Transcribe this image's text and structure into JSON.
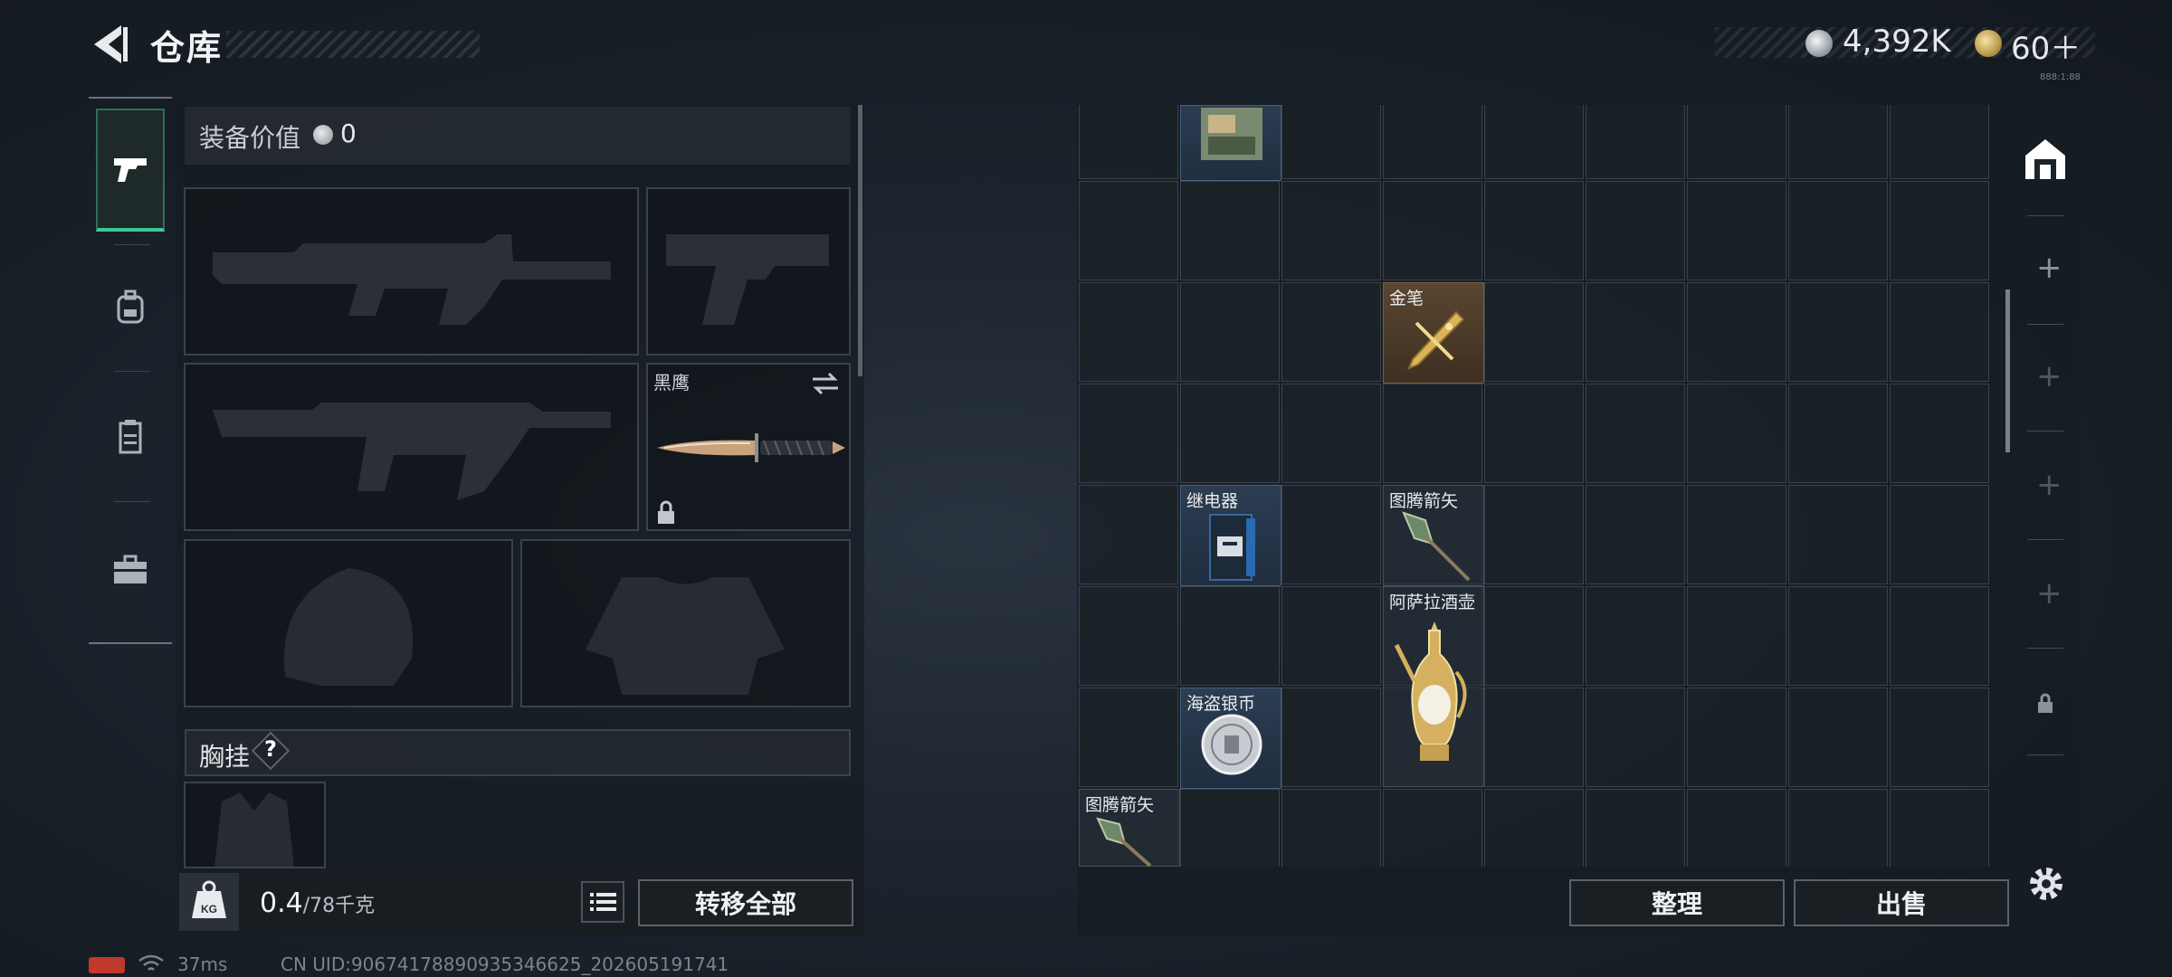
{
  "header": {
    "title": "仓库",
    "currency": {
      "silver": "4,392K",
      "gold": "60＋"
    },
    "tiny_id": "888:1:88"
  },
  "left_rail": {
    "tabs": [
      {
        "icon": "pistol-icon",
        "active": true
      },
      {
        "icon": "backpack-icon",
        "active": false
      },
      {
        "icon": "armor-vest-icon",
        "active": false
      },
      {
        "icon": "toolbox-icon",
        "active": false
      }
    ]
  },
  "equipment": {
    "value_label": "装备价值",
    "value": "0",
    "melee_label": "黑鹰",
    "chest_rig_label": "胸挂",
    "help": "?"
  },
  "bottom_left": {
    "weight_current": "0.4",
    "weight_max": "/78千克",
    "kg_label": "KG",
    "transfer_all": "转移全部"
  },
  "storage": {
    "items": [
      {
        "name": "",
        "kind": "magazine"
      },
      {
        "name": "金笔",
        "kind": "golden-pen"
      },
      {
        "name": "继电器",
        "kind": "relay"
      },
      {
        "name": "图腾箭矢",
        "kind": "totem-arrow"
      },
      {
        "name": "阿萨拉酒壶",
        "kind": "wine-ewer"
      },
      {
        "name": "海盗银币",
        "kind": "silver-coin"
      },
      {
        "name": "图腾箭矢",
        "kind": "totem-arrow"
      }
    ],
    "sort_label": "整理",
    "sell_label": "出售"
  },
  "status_bar": {
    "ping": "37ms",
    "uid": "CN UID:906741788909353466​25_202605191741"
  },
  "colors": {
    "accent": "#3ec79a",
    "gold_item": "#5a4630",
    "blue_item": "#2c3d52"
  }
}
